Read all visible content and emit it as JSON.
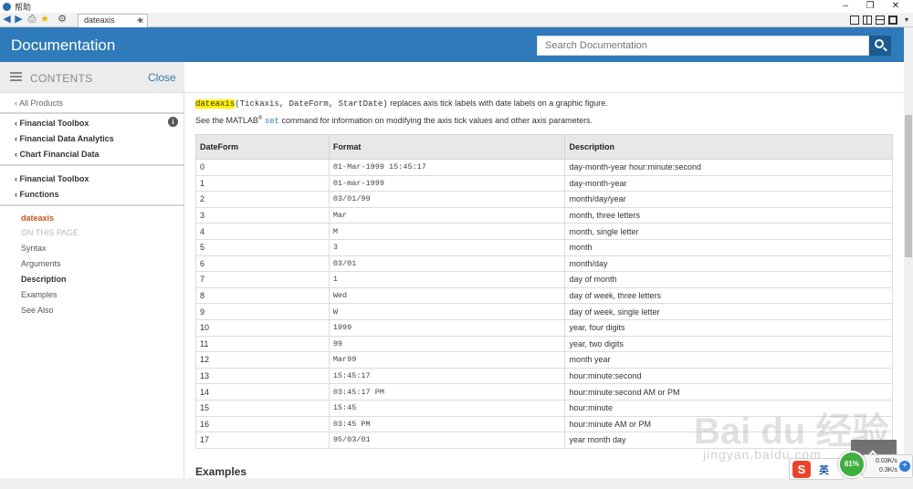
{
  "window": {
    "title": "帮助",
    "controls": [
      "–",
      "❐",
      "✕"
    ]
  },
  "browser": {
    "tab_title": "dateaxis",
    "tab_close": "x",
    "new_tab": "+",
    "nav_icons": [
      "back-icon",
      "forward-icon",
      "print-icon",
      "favorites-icon",
      "settings-icon"
    ],
    "layout_icons": [
      "grid-layout-icon",
      "vertical-split-icon",
      "horizontal-split-icon",
      "single-pane-icon",
      "more-icon"
    ]
  },
  "header": {
    "brand": "Documentation",
    "search_placeholder": "Search Documentation"
  },
  "sidebar": {
    "contents_label": "CONTENTS",
    "close_label": "Close",
    "all_products": "‹ All Products",
    "breadcrumb1": [
      "‹ Financial Toolbox",
      "‹ Financial Data Analytics",
      "‹ Chart Financial Data"
    ],
    "breadcrumb2": [
      "‹ Financial Toolbox",
      "‹ Functions"
    ],
    "current_page": "dateaxis",
    "on_this_page": "ON THIS PAGE",
    "page_sections": [
      "Syntax",
      "Arguments",
      "Description",
      "Examples",
      "See Also"
    ]
  },
  "main": {
    "intro_func": "dateaxis",
    "intro_args": "(Tickaxis, DateForm, StartDate)",
    "intro_rest": " replaces axis tick labels with date labels on a graphic figure.",
    "see_prefix": "See the MATLAB",
    "see_reg": "®",
    "see_link": "set",
    "see_rest": " command for information on modifying the axis tick values and other axis parameters.",
    "table_headers": [
      "DateForm",
      "Format",
      "Description"
    ],
    "table_rows": [
      [
        "0",
        "01-Mar-1999 15:45:17",
        "day-month-year hour:minute:second"
      ],
      [
        "1",
        "01-mar-1999",
        "day-month-year"
      ],
      [
        "2",
        "03/01/99",
        "month/day/year"
      ],
      [
        "3",
        "Mar",
        "month, three letters"
      ],
      [
        "4",
        "M",
        "month, single letter"
      ],
      [
        "5",
        "3",
        "month"
      ],
      [
        "6",
        "03/01",
        "month/day"
      ],
      [
        "7",
        "1",
        "day of month"
      ],
      [
        "8",
        "Wed",
        "day of week, three letters"
      ],
      [
        "9",
        "W",
        "day of week, single letter"
      ],
      [
        "10",
        "1999",
        "year, four digits"
      ],
      [
        "11",
        "99",
        "year, two digits"
      ],
      [
        "12",
        "Mar99",
        "month year"
      ],
      [
        "13",
        "15:45:17",
        "hour:minute:second"
      ],
      [
        "14",
        "03:45:17 PM",
        "hour:minute:second AM or PM"
      ],
      [
        "15",
        "15:45",
        "hour:minute"
      ],
      [
        "16",
        "03:45 PM",
        "hour:minute AM or PM"
      ],
      [
        "17",
        "95/03/01",
        "year month day"
      ]
    ],
    "examples_heading": "Examples"
  },
  "overlays": {
    "watermark": "Bai du 经验",
    "watermark_url": "jingyan.baidu.com",
    "ime_logo": "S",
    "ime_lang": "英",
    "net_percent": "61%",
    "net_up": "0.03K/s",
    "net_down": "0.3K/s",
    "net_plus": "+"
  }
}
